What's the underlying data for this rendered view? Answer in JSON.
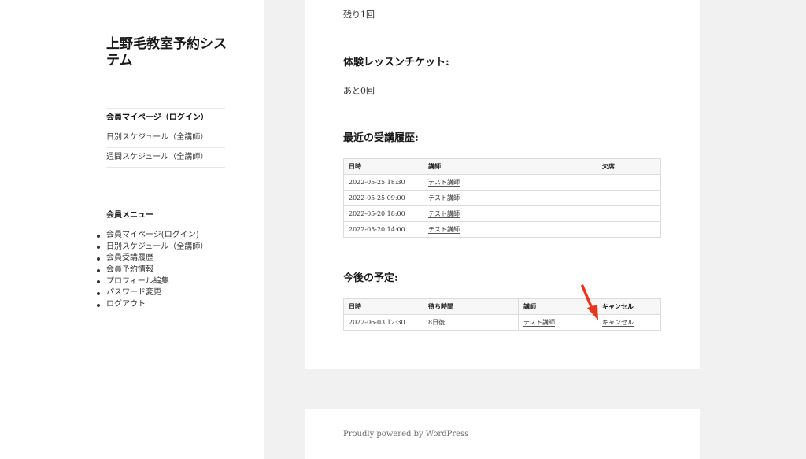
{
  "site": {
    "title": "上野毛教室予約システム"
  },
  "top_nav": [
    {
      "label": "会員マイページ（ログイン）"
    },
    {
      "label": "日別スケジュール（全講師）"
    },
    {
      "label": "週間スケジュール（全講師）"
    }
  ],
  "member_menu": {
    "title": "会員メニュー",
    "items": [
      {
        "label": "会員マイページ(ログイン)"
      },
      {
        "label": "日別スケジュール（全講師）"
      },
      {
        "label": "会員受講履歴"
      },
      {
        "label": "会員予約情報"
      },
      {
        "label": "プロフィール編集"
      },
      {
        "label": "パスワード変更"
      },
      {
        "label": "ログアウト"
      }
    ]
  },
  "content": {
    "remaining_text": "残り1回",
    "trial_title": "体験レッスンチケット:",
    "trial_text": "あと0回",
    "history_title": "最近の受講履歴:",
    "history": {
      "headers": [
        "日時",
        "講師",
        "欠席"
      ],
      "rows": [
        {
          "datetime": "2022-05-25 18:30",
          "teacher": "テスト講師",
          "absent": ""
        },
        {
          "datetime": "2022-05-25 09:00",
          "teacher": "テスト講師",
          "absent": ""
        },
        {
          "datetime": "2022-05-20 18:00",
          "teacher": "テスト講師",
          "absent": ""
        },
        {
          "datetime": "2022-05-20 14:00",
          "teacher": "テスト講師",
          "absent": ""
        }
      ]
    },
    "upcoming_title": "今後の予定:",
    "upcoming": {
      "headers": [
        "日時",
        "待ち時間",
        "講師",
        "キャンセル"
      ],
      "rows": [
        {
          "datetime": "2022-06-03 12:30",
          "wait": "8日後",
          "teacher": "テスト講師",
          "cancel": "キャンセル"
        }
      ]
    }
  },
  "footer": {
    "powered_by": "Proudly powered by WordPress"
  },
  "colors": {
    "annotation_arrow": "#e8351e",
    "background": "#f1f1f1"
  }
}
